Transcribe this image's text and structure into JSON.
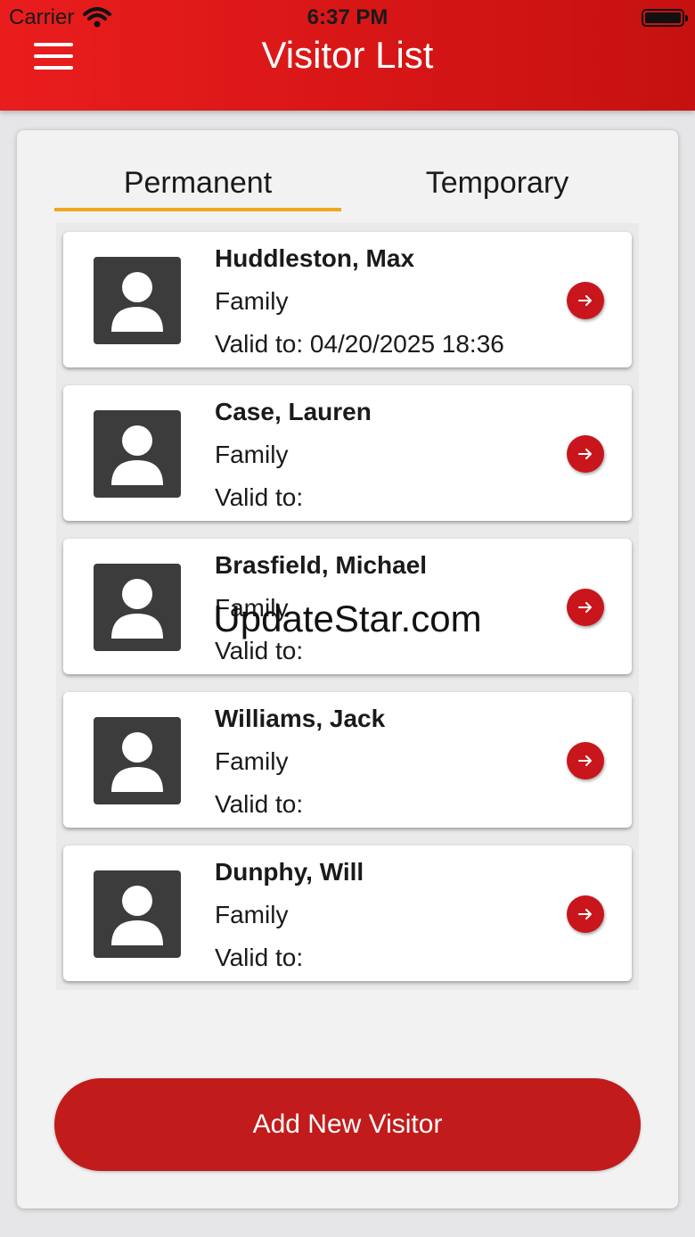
{
  "status_bar": {
    "carrier": "Carrier",
    "time": "6:37 PM"
  },
  "header": {
    "title": "Visitor List"
  },
  "tabs": [
    {
      "label": "Permanent",
      "selected": true
    },
    {
      "label": "Temporary",
      "selected": false
    }
  ],
  "visitors": [
    {
      "name": "Huddleston, Max",
      "relation": "Family",
      "valid_to": "Valid to: 04/20/2025 18:36"
    },
    {
      "name": "Case, Lauren",
      "relation": "Family",
      "valid_to": "Valid to:"
    },
    {
      "name": "Brasfield, Michael",
      "relation": "Family",
      "valid_to": "Valid to:"
    },
    {
      "name": "Williams, Jack",
      "relation": "Family",
      "valid_to": "Valid to:"
    },
    {
      "name": "Dunphy, Will",
      "relation": "Family",
      "valid_to": "Valid to:"
    }
  ],
  "add_button_label": "Add New Visitor",
  "watermark": "UpdateStar.com",
  "colors": {
    "header": "#e01a1a",
    "accent_underline": "#f0a81c",
    "button": "#c11b1b",
    "avatar": "#3c3c3c"
  },
  "icons": {
    "menu": "hamburger-icon",
    "avatar": "person-icon",
    "row_action": "arrow-right-icon"
  }
}
